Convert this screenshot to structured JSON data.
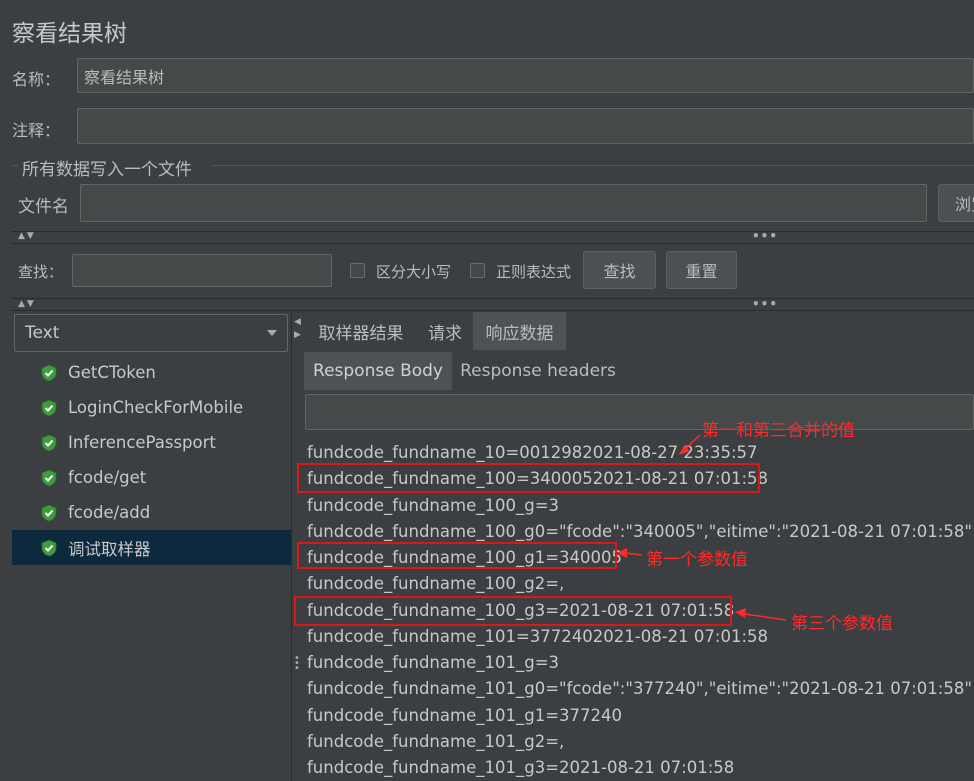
{
  "window_title": "察看结果树",
  "name_label": "名称：",
  "name_value": "察看结果树",
  "comment_label": "注释：",
  "comment_value": "",
  "file_section_title": "所有数据写入一个文件",
  "filename_label": "文件名",
  "filename_value": "",
  "browse_label": "浏览",
  "search": {
    "label": "查找：",
    "value": "",
    "case_sensitive_label": "区分大小写",
    "regex_label": "正则表达式",
    "find_button": "查找",
    "reset_button": "重置"
  },
  "renderer_select": "Text",
  "tree_items": [
    {
      "label": "GetCToken",
      "status": "success"
    },
    {
      "label": "LoginCheckForMobile",
      "status": "success"
    },
    {
      "label": "InferencePassport",
      "status": "success"
    },
    {
      "label": "fcode/get",
      "status": "success"
    },
    {
      "label": "fcode/add",
      "status": "success"
    },
    {
      "label": "调试取样器",
      "status": "success",
      "selected": true
    }
  ],
  "tabs": [
    "取样器结果",
    "请求",
    "响应数据"
  ],
  "active_tab": "响应数据",
  "subtabs": [
    "Response Body",
    "Response headers"
  ],
  "active_subtab": "Response Body",
  "response_lines": [
    "fundcode_fundname_10=0012982021-08-27 23:35:57",
    "fundcode_fundname_100=3400052021-08-21 07:01:58",
    "fundcode_fundname_100_g=3",
    "fundcode_fundname_100_g0=\"fcode\":\"340005\",\"eitime\":\"2021-08-21 07:01:58\"",
    "fundcode_fundname_100_g1=340005",
    "fundcode_fundname_100_g2=,",
    "fundcode_fundname_100_g3=2021-08-21 07:01:58",
    "fundcode_fundname_101=3772402021-08-21 07:01:58",
    "fundcode_fundname_101_g=3",
    "fundcode_fundname_101_g0=\"fcode\":\"377240\",\"eitime\":\"2021-08-21 07:01:58\"",
    "fundcode_fundname_101_g1=377240",
    "fundcode_fundname_101_g2=,",
    "fundcode_fundname_101_g3=2021-08-21 07:01:58"
  ],
  "annotations": {
    "combined": "第一和第三合并的值",
    "first_param": "第一个参数值",
    "third_param": "第三个参数值"
  },
  "colors": {
    "background": "#3c3f41",
    "selected": "#0d293e",
    "highlight_red": "#d91818",
    "success_green": "#3e9b3e"
  }
}
